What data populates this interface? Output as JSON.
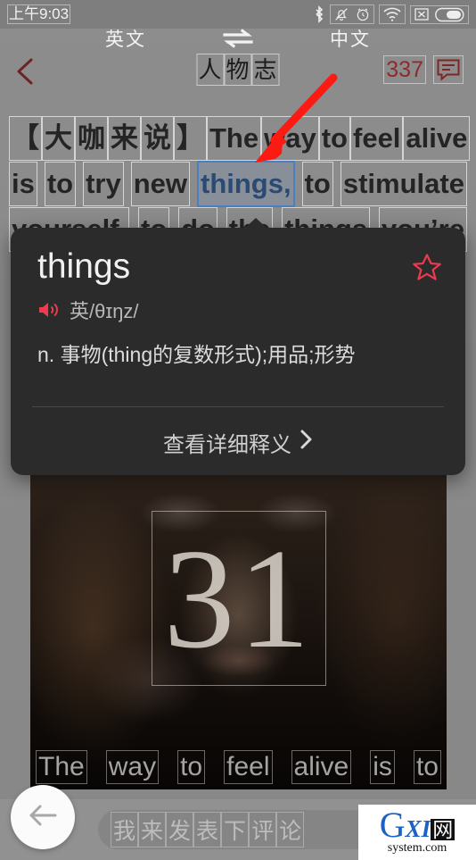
{
  "status_bar": {
    "time": "上午9:03",
    "icons": [
      "bluetooth-icon",
      "mute-bell-icon",
      "alarm-icon",
      "wifi-icon",
      "no-signal-icon",
      "battery-icon"
    ]
  },
  "language_bar": {
    "source": "英文",
    "swap_icon": "swap-arrows-icon",
    "target": "中文"
  },
  "nav_bar": {
    "back_icon": "back-chevron-icon",
    "title": "人物志",
    "title_chars": [
      "人",
      "物",
      "志"
    ],
    "comment_count": "337",
    "comment_icon": "comment-bubble-icon"
  },
  "article": {
    "lines": [
      {
        "words": [
          {
            "t": "【",
            "sel": false
          },
          {
            "t": "大",
            "sel": false
          },
          {
            "t": "咖",
            "sel": false
          },
          {
            "t": "来",
            "sel": false
          },
          {
            "t": "说",
            "sel": false
          },
          {
            "t": "】",
            "sel": false
          },
          {
            "t": "The",
            "sel": false
          },
          {
            "t": "way",
            "sel": false
          },
          {
            "t": "to",
            "sel": false
          },
          {
            "t": "feel",
            "sel": false
          },
          {
            "t": "alive",
            "sel": false
          }
        ]
      },
      {
        "words": [
          {
            "t": "is",
            "sel": false
          },
          {
            "t": "to",
            "sel": false
          },
          {
            "t": "try",
            "sel": false
          },
          {
            "t": "new",
            "sel": false
          },
          {
            "t": "things,",
            "sel": true
          },
          {
            "t": "to",
            "sel": false
          },
          {
            "t": "stimulate",
            "sel": false
          }
        ]
      },
      {
        "words": [
          {
            "t": "yourself,",
            "sel": false
          },
          {
            "t": "to",
            "sel": false
          },
          {
            "t": "do",
            "sel": false
          },
          {
            "t": "the",
            "sel": false
          },
          {
            "t": "things",
            "sel": false
          },
          {
            "t": "you’re",
            "sel": false
          }
        ]
      }
    ],
    "image": {
      "number": "31",
      "caption_words": [
        "The",
        "way",
        "to",
        "feel",
        "alive",
        "is",
        "to"
      ]
    }
  },
  "dictionary_popup": {
    "word": "things",
    "favorite_icon": "star-outline-icon",
    "speaker_icon": "speaker-icon",
    "phonetic": "英/θɪŋz/",
    "definition": "n. 事物(thing的复数形式);用品;形势",
    "more_label": "查看详细释义",
    "more_chevron_icon": "chevron-right-icon",
    "accent_color": "#e8374a",
    "background_color": "#2b2b2b"
  },
  "bottom_bar": {
    "fab_icon": "back-arrow-icon",
    "comment_placeholder": "我来发表下评论",
    "comment_placeholder_chars": [
      "我",
      "来",
      "发",
      "表",
      "下",
      "评",
      "论"
    ],
    "share_icon": "share-icon"
  },
  "annotation": {
    "arrow_icon": "red-pointer-arrow",
    "color": "#fb1b12"
  },
  "watermark": {
    "brand_g": "G",
    "brand_xi": "XI",
    "brand_wang": "网",
    "domain": "system.com"
  }
}
